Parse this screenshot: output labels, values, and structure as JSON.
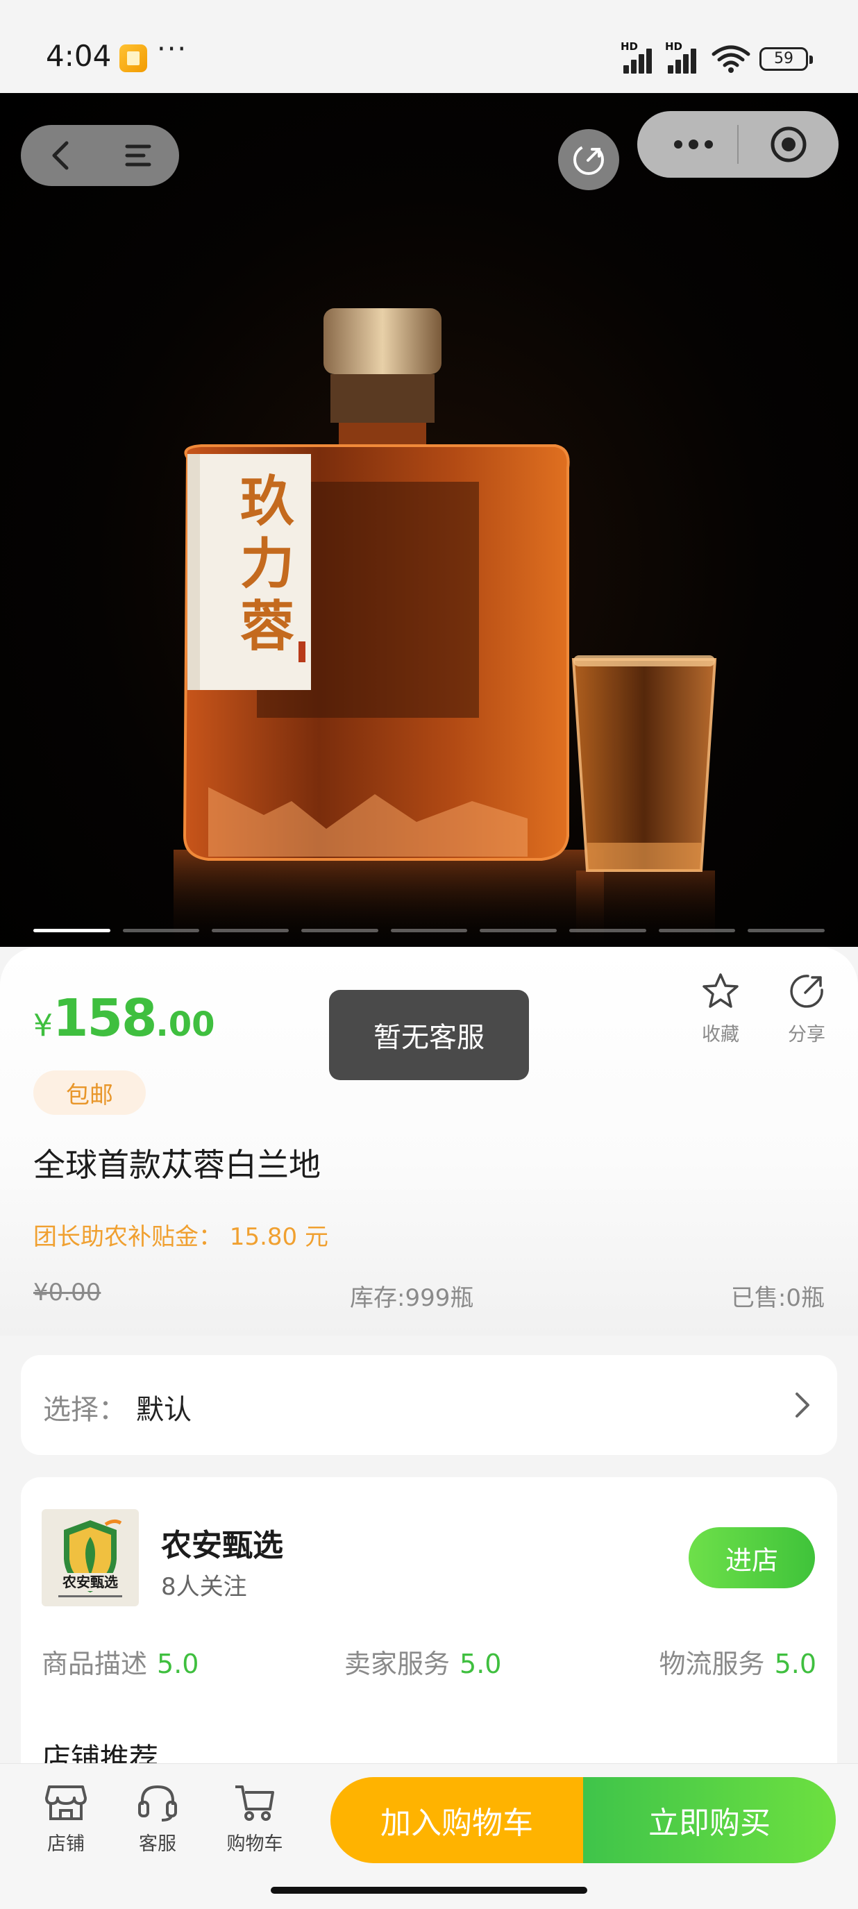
{
  "status_bar": {
    "time": "4:04",
    "dots": "···",
    "battery": "59",
    "signal_label": "HD"
  },
  "hero": {
    "image_label_lines": [
      "玖",
      "力",
      "蓉"
    ],
    "carousel": {
      "count": 9,
      "active_index": 0
    }
  },
  "product": {
    "currency": "¥",
    "price_int": "158",
    "price_dec": ".00",
    "free_shipping": "包邮",
    "title": "全球首款苁蓉白兰地",
    "subsidy": "团长助农补贴金：  15.80 元",
    "original_price": "¥0.00",
    "stock": "库存:999瓶",
    "sold": "已售:0瓶"
  },
  "actions": {
    "favorite": "收藏",
    "share": "分享"
  },
  "toast": "暂无客服",
  "select": {
    "label": "选择：",
    "value": "默认"
  },
  "store": {
    "name": "农安甄选",
    "logo_text": "农安甄选",
    "followers": "8人关注",
    "enter_button": "进店",
    "ratings": [
      {
        "label": "商品描述",
        "value": "5.0"
      },
      {
        "label": "卖家服务",
        "value": "5.0"
      },
      {
        "label": "物流服务",
        "value": "5.0"
      }
    ],
    "recommend_title": "店铺推荐"
  },
  "bottom_bar": {
    "tabs": [
      {
        "label": "店铺",
        "icon": "store-icon"
      },
      {
        "label": "客服",
        "icon": "headset-icon"
      },
      {
        "label": "购物车",
        "icon": "cart-icon"
      }
    ],
    "add_to_cart": "加入购物车",
    "buy_now": "立即购买"
  },
  "colors": {
    "accent_green": "#3fbf3f",
    "orange": "#ffb300",
    "subsidy_orange": "#f0a030"
  }
}
